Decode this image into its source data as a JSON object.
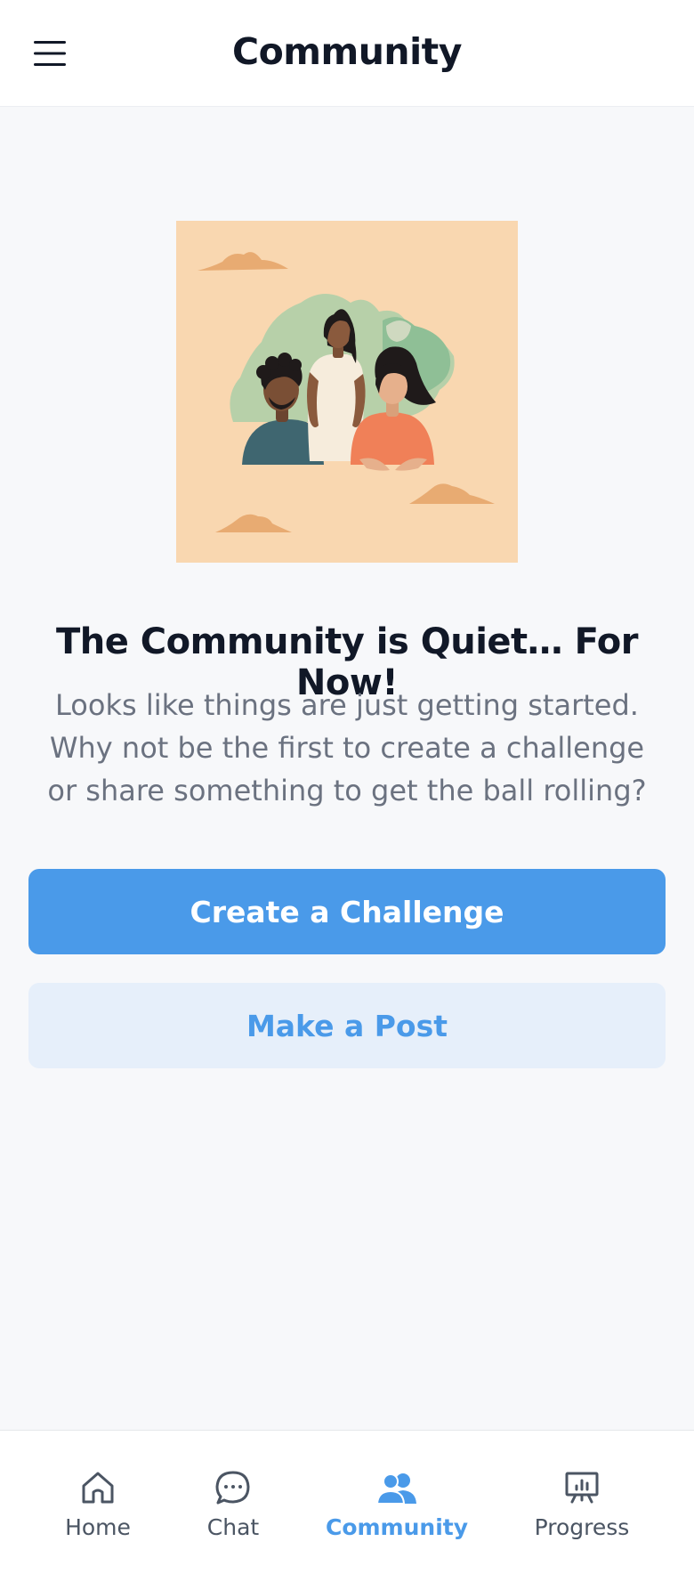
{
  "header": {
    "title": "Community",
    "menu_icon": "hamburger-menu-icon"
  },
  "empty_state": {
    "illustration": "community-people-illustration",
    "title": "The Community is Quiet… For Now!",
    "description": "Looks like things are just getting started. Why not be the first to create a challenge or share something to get the ball rolling?"
  },
  "actions": {
    "primary_label": "Create a Challenge",
    "secondary_label": "Make a Post"
  },
  "bottom_nav": {
    "items": [
      {
        "label": "Home",
        "icon": "home-icon"
      },
      {
        "label": "Chat",
        "icon": "chat-bubble-icon"
      },
      {
        "label": "Community",
        "icon": "people-icon",
        "active": true
      },
      {
        "label": "Progress",
        "icon": "presentation-chart-icon"
      }
    ]
  },
  "colors": {
    "accent": "#4a9ae9",
    "accent_light": "#e6effa",
    "background": "#f7f8fa",
    "text_primary": "#111827",
    "text_secondary": "#6b7280",
    "illustration_bg": "#f9d7b0"
  }
}
